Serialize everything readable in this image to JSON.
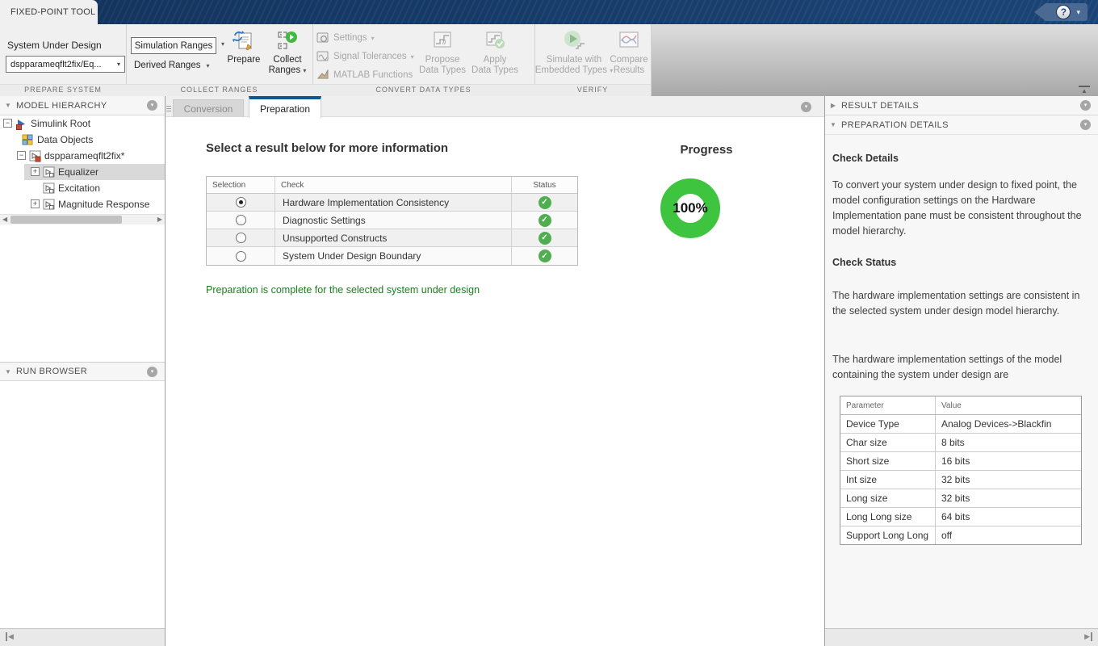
{
  "titlebar": {
    "tab_label": "FIXED-POINT TOOL"
  },
  "icons": {
    "caret_down": "▾",
    "tri_down": "▼",
    "tri_right": "▶",
    "check": "✓",
    "help": "?",
    "collapse_up": "▲",
    "left_arrow": "◀",
    "right_arrow": "▶",
    "expander_open": "−",
    "expander_closed": "+"
  },
  "colors": {
    "accent_blue": "#12568e",
    "titlebar_navy": "#143864",
    "progress_green": "#3fc43f",
    "status_pass_green": "#4fae4f",
    "message_green": "#1e7e1e"
  },
  "ribbon": {
    "section_labels": [
      "PREPARE SYSTEM",
      "COLLECT RANGES",
      "CONVERT DATA TYPES",
      "VERIFY"
    ],
    "system_under_design_label": "System Under Design",
    "system_under_design_value": "dspparameqflt2fix/Eq...",
    "simulation_ranges_label": "Simulation Ranges",
    "derived_ranges_label": "Derived Ranges",
    "prepare_label": "Prepare",
    "collect_ranges_line1": "Collect",
    "collect_ranges_line2": "Ranges",
    "settings_label": "Settings",
    "signal_tolerances_label": "Signal Tolerances",
    "matlab_functions_label": "MATLAB Functions",
    "propose_line1": "Propose",
    "propose_line2": "Data Types",
    "apply_line1": "Apply",
    "apply_line2": "Data Types",
    "simulate_line1": "Simulate with",
    "simulate_line2": "Embedded Types",
    "compare_line1": "Compare",
    "compare_line2": "Results"
  },
  "left_panel": {
    "model_hierarchy_title": "MODEL HIERARCHY",
    "run_browser_title": "RUN BROWSER",
    "tree": [
      {
        "label": "Simulink Root",
        "level": 0,
        "expander": "open",
        "icon": "simulink-root",
        "selected": false
      },
      {
        "label": "Data Objects",
        "level": 1,
        "expander": null,
        "icon": "data-objects",
        "selected": false
      },
      {
        "label": "dspparameqflt2fix*",
        "level": 1,
        "expander": "open",
        "icon": "model",
        "selected": false
      },
      {
        "label": "Equalizer",
        "level": 2,
        "expander": "closed",
        "icon": "subsystem",
        "selected": true
      },
      {
        "label": "Excitation",
        "level": 2,
        "expander": null,
        "icon": "subsystem",
        "selected": false
      },
      {
        "label": "Magnitude Response",
        "level": 2,
        "expander": "closed",
        "icon": "subsystem",
        "selected": false
      }
    ]
  },
  "center": {
    "tabs": [
      {
        "label": "Conversion",
        "active": false
      },
      {
        "label": "Preparation",
        "active": true
      }
    ],
    "heading": "Select a result below for more information",
    "table": {
      "headers": [
        "Selection",
        "Check",
        "Status"
      ],
      "rows": [
        {
          "check": "Hardware Implementation Consistency",
          "selected": true,
          "status": "pass"
        },
        {
          "check": "Diagnostic Settings",
          "selected": false,
          "status": "pass"
        },
        {
          "check": "Unsupported Constructs",
          "selected": false,
          "status": "pass"
        },
        {
          "check": "System Under Design Boundary",
          "selected": false,
          "status": "pass"
        }
      ]
    },
    "message": "Preparation is complete for the selected system under design",
    "progress": {
      "title": "Progress",
      "value": "100%",
      "percent": 100
    }
  },
  "right_panel": {
    "result_details_title": "RESULT DETAILS",
    "preparation_details_title": "PREPARATION DETAILS",
    "check_details_heading": "Check Details",
    "check_details_text": "To convert your system under design to fixed point, the model configuration settings on the Hardware Implementation pane must be consistent throughout the model hierarchy.",
    "check_status_heading": "Check Status",
    "check_status_text": "The hardware implementation settings are consistent in the selected system under design model hierarchy.",
    "hw_settings_text": "The hardware implementation settings of the model containing the system under design are",
    "table": {
      "headers": [
        "Parameter",
        "Value"
      ],
      "rows": [
        {
          "parameter": "Device Type",
          "value": "Analog Devices->Blackfin"
        },
        {
          "parameter": "Char size",
          "value": "8 bits"
        },
        {
          "parameter": "Short size",
          "value": "16 bits"
        },
        {
          "parameter": "Int size",
          "value": "32 bits"
        },
        {
          "parameter": "Long size",
          "value": "32 bits"
        },
        {
          "parameter": "Long Long size",
          "value": "64 bits"
        },
        {
          "parameter": "Support Long Long",
          "value": "off"
        }
      ]
    }
  }
}
